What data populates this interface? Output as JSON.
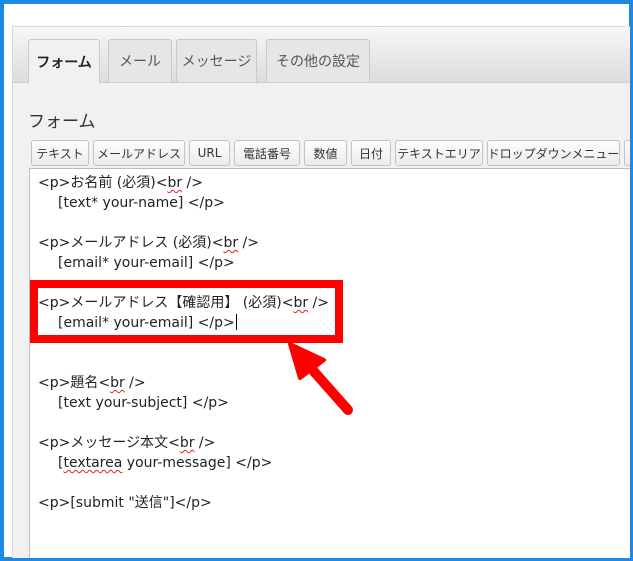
{
  "tabs": [
    {
      "label": "フォーム",
      "active": true
    },
    {
      "label": "メール",
      "active": false
    },
    {
      "label": "メッセージ",
      "active": false
    },
    {
      "label": "その他の設定",
      "active": false
    }
  ],
  "section_title": "フォーム",
  "toolbar": {
    "buttons": [
      "テキスト",
      "メールアドレス",
      "URL",
      "電話番号",
      "数値",
      "日付",
      "テキストエリア",
      "ドロップダウンメニュー"
    ]
  },
  "editor": {
    "lines": [
      {
        "a": "<p>お名前 (必須)<",
        "sq": "br",
        "b": " />"
      },
      {
        "a": "[text* your-name] </p>",
        "sq": "",
        "b": ""
      },
      {
        "a": "<p>メールアドレス (必須)<",
        "sq": "br",
        "b": " />"
      },
      {
        "a": "[email* your-email] </p>",
        "sq": "",
        "b": ""
      },
      {
        "a": "<p>メールアドレス【確認用】 (必須)<",
        "sq": "br",
        "b": " />"
      },
      {
        "a": "[email* your-email] </p>",
        "sq": "",
        "b": ""
      },
      {
        "a": "<p>題名<",
        "sq": "br",
        "b": " />"
      },
      {
        "a": "[text your-subject] </p>",
        "sq": "",
        "b": ""
      },
      {
        "a": "<p>メッセージ本文<",
        "sq": "br",
        "b": " />"
      },
      {
        "a": "[",
        "sq": "textarea",
        "b": " your-message] </p>"
      },
      {
        "a": "<p>[submit \"送信\"]</p>",
        "sq": "",
        "b": ""
      }
    ]
  },
  "colors": {
    "frame_border": "#1e88e5",
    "highlight": "#ff0000",
    "spellcheck_underline": "#e02020"
  }
}
